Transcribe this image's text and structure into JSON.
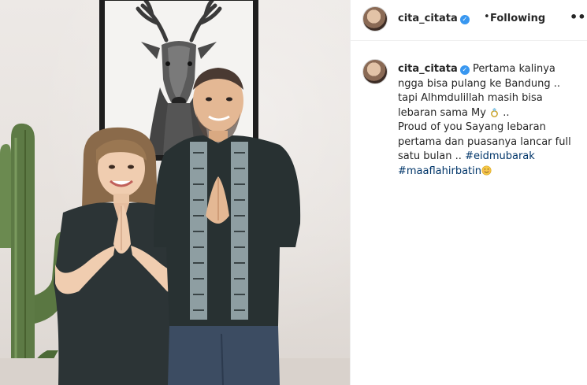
{
  "post": {
    "username": "cita_citata",
    "follow_status": "Following",
    "separator": "•",
    "more_glyph": "•••",
    "verified_glyph": "✓",
    "caption": {
      "line1": "Pertama kalinya ngga",
      "line2": "bisa pulang ke Bandung .. tapi",
      "line3": "Alhmdulillah masih bisa lebaran sama",
      "line4": "My",
      "line4_suffix": "..",
      "line5": "Proud of you Sayang lebaran pertama",
      "line6": "dan puasanya lancar full satu bulan ..",
      "hashtag1": "#eidmubarak",
      "hashtag2": "#maaflahirbatin"
    },
    "emoji": {
      "ring": "ring-emoji",
      "smile": "smiling-face-emoji"
    }
  },
  "photo": {
    "subject": "couple-photo",
    "decor": [
      "deer-portrait-frame",
      "cactus"
    ]
  },
  "colors": {
    "hashtag": "#003569",
    "verified": "#3897f0",
    "border": "#efefef"
  }
}
